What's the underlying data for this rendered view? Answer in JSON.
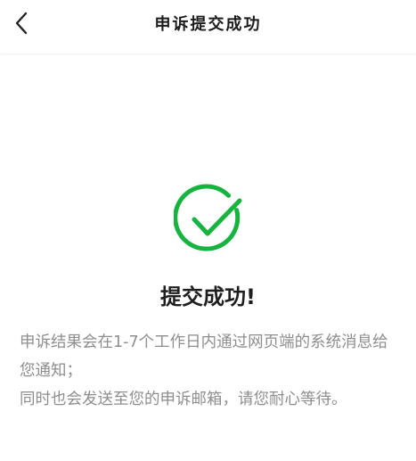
{
  "header": {
    "title": "申诉提交成功",
    "back_icon": "chevron-left-icon"
  },
  "result": {
    "icon": "check-circle-icon",
    "icon_color": "#16B33F",
    "heading": "提交成功!",
    "lines": [
      "申诉结果会在1-7个工作日内通过网页端的系统消息给您通知；",
      "同时也会发送至您的申诉邮箱，请您耐心等待。"
    ]
  }
}
